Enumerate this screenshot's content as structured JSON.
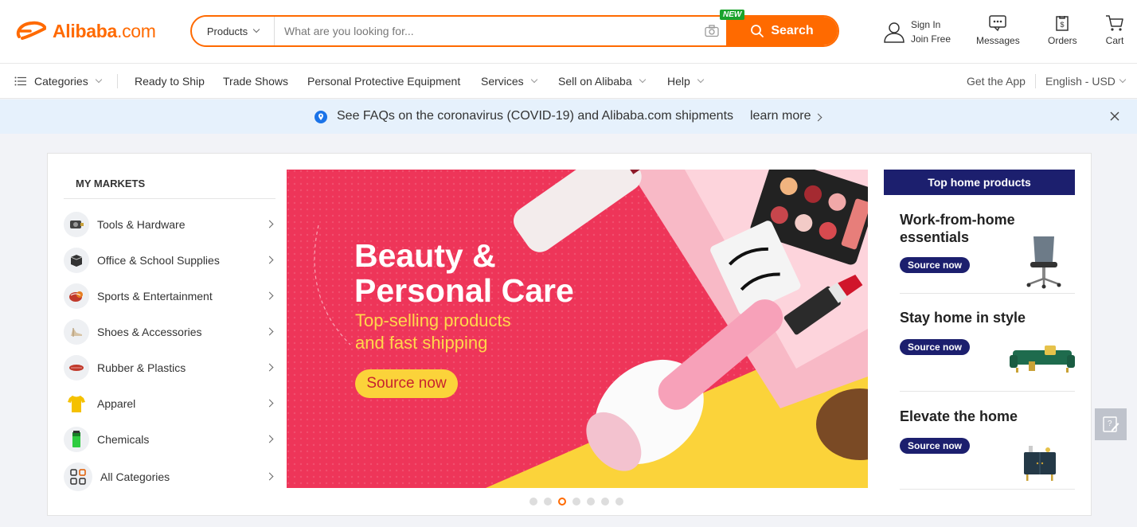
{
  "header": {
    "logo_text": "Alibaba",
    "logo_suffix": ".com",
    "search": {
      "category": "Products",
      "placeholder": "What are you looking for...",
      "new_badge": "NEW",
      "button": "Search"
    },
    "signin": "Sign In",
    "join": "Join Free",
    "messages": "Messages",
    "orders": "Orders",
    "cart": "Cart"
  },
  "nav": {
    "categories": "Categories",
    "items": [
      "Ready to Ship",
      "Trade Shows",
      "Personal Protective Equipment",
      "Services",
      "Sell on Alibaba",
      "Help"
    ],
    "get_app": "Get the App",
    "language": "English - USD"
  },
  "notice": {
    "text": "See FAQs on the coronavirus (COVID-19) and Alibaba.com shipments",
    "link": "learn more"
  },
  "markets": {
    "title": "MY MARKETS",
    "items": [
      "Tools & Hardware",
      "Office & School Supplies",
      "Sports & Entertainment",
      "Shoes & Accessories",
      "Rubber & Plastics",
      "Apparel",
      "Chemicals",
      "All Categories"
    ]
  },
  "banner": {
    "title_line1": "Beauty &",
    "title_line2": "Personal Care",
    "subtitle_line1": "Top-selling products",
    "subtitle_line2": "and fast shipping",
    "button": "Source now",
    "slide_count": 7,
    "active_slide": 3
  },
  "top_products": {
    "header": "Top home products",
    "cards": [
      {
        "title": "Work-from-home essentials",
        "button": "Source now"
      },
      {
        "title": "Stay home in style",
        "button": "Source now"
      },
      {
        "title": "Elevate the home",
        "button": "Source now"
      }
    ]
  },
  "colors": {
    "accent": "#ff6a00",
    "navy": "#1c1f6e",
    "banner_pink": "#ee3559",
    "banner_yellow": "#fbd33a"
  }
}
